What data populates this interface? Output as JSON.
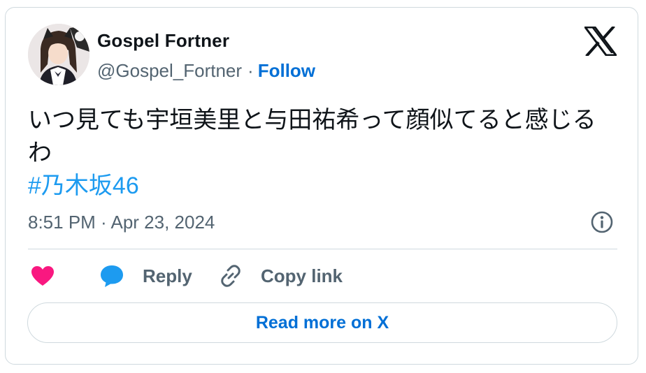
{
  "author": {
    "display_name": "Gospel Fortner",
    "handle": "@Gospel_Fortner",
    "separator": "·",
    "follow_label": "Follow"
  },
  "tweet": {
    "text": "いつ見ても宇垣美里と与田祐希って顔似てると感じるわ",
    "hashtag": "#乃木坂46",
    "timestamp": "8:51 PM · Apr 23, 2024"
  },
  "actions": {
    "like_icon": "heart-icon",
    "reply_label": "Reply",
    "copy_link_label": "Copy link"
  },
  "read_more_label": "Read more on X",
  "colors": {
    "like": "#f91880",
    "reply": "#1d9bf0",
    "link": "#006fd6",
    "hashtag": "#1d9bf0",
    "muted_text": "#536471",
    "border": "#cfd9de"
  }
}
